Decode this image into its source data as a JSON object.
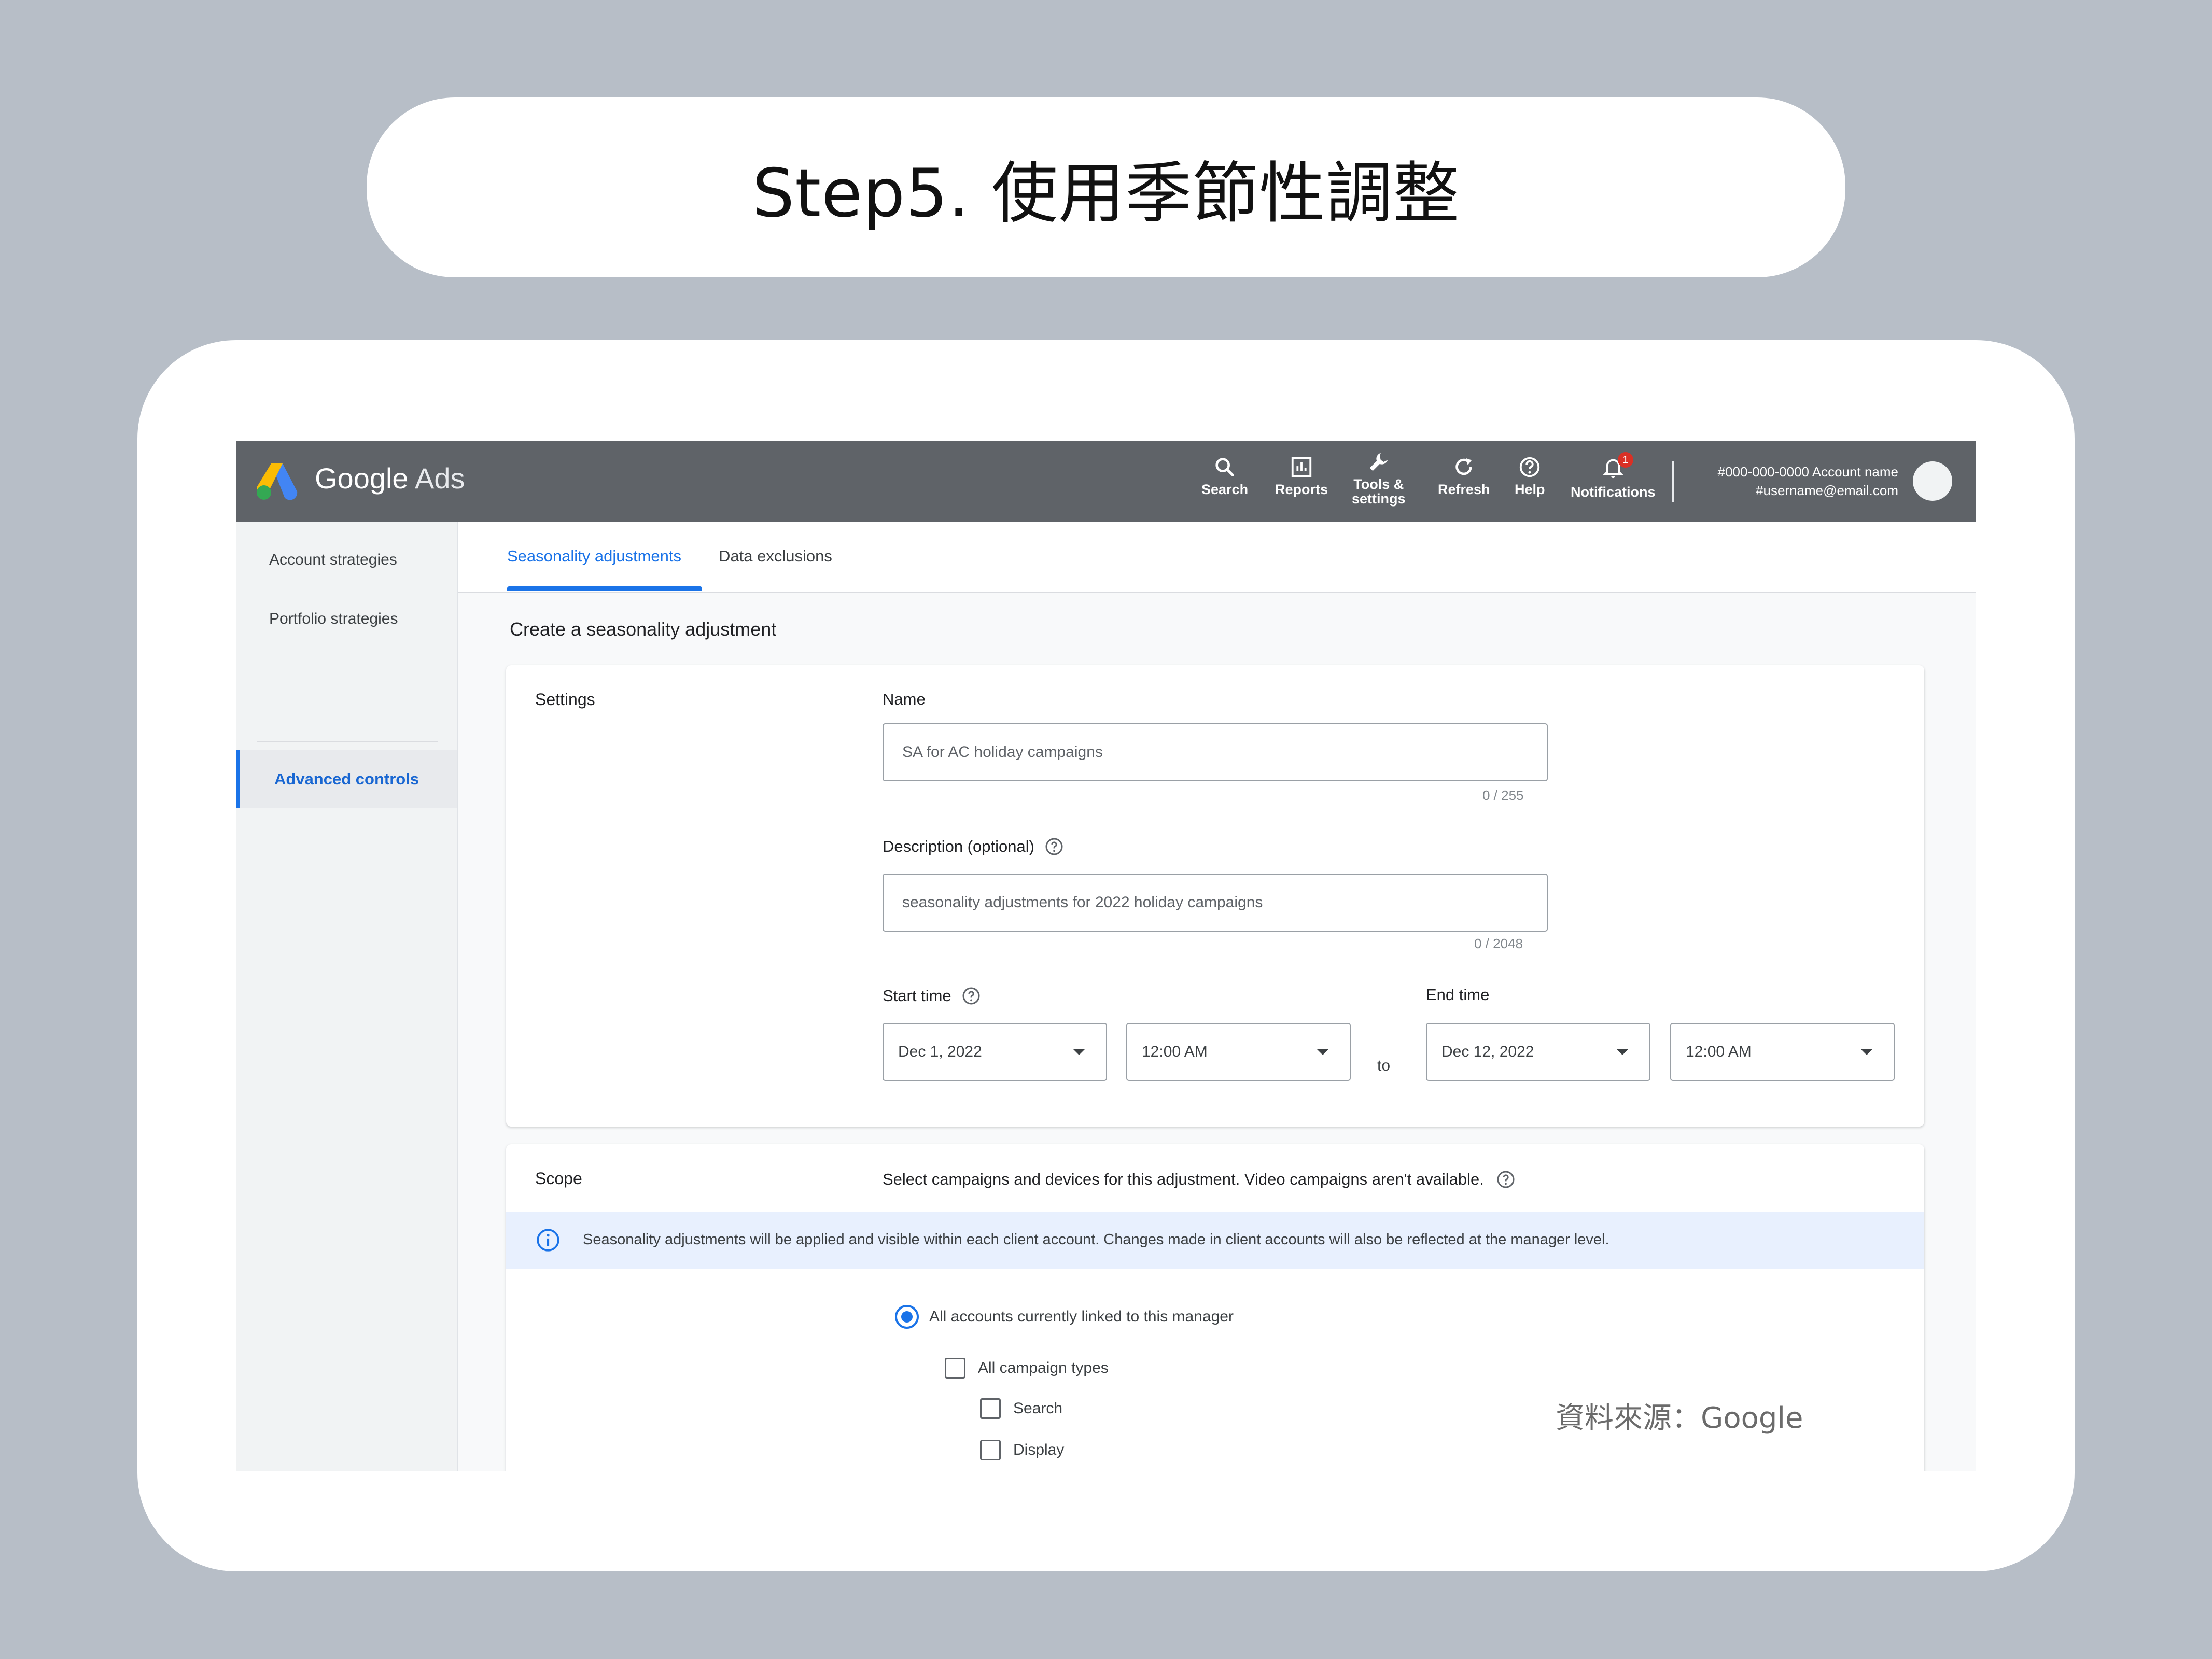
{
  "slide": {
    "title": "Step5. 使用季節性調整",
    "source_note": "資料來源：Google"
  },
  "topbar": {
    "brand": "Google",
    "brand_suffix": "Ads",
    "tools": [
      {
        "label": "Search",
        "icon": "search-icon"
      },
      {
        "label": "Reports",
        "icon": "reports-icon"
      },
      {
        "label": "Tools &\nsettings",
        "icon": "wrench-icon"
      },
      {
        "label": "Refresh",
        "icon": "refresh-icon"
      },
      {
        "label": "Help",
        "icon": "help-icon"
      },
      {
        "label": "Notifications",
        "icon": "bell-icon",
        "badge": "1"
      }
    ],
    "account_line1": "#000-000-0000 Account name",
    "account_line2": "#username@email.com"
  },
  "sidebar": {
    "items": [
      {
        "label": "Account strategies"
      },
      {
        "label": "Portfolio strategies"
      },
      {
        "label": "Advanced controls",
        "active": true
      }
    ]
  },
  "tabs": [
    {
      "label": "Seasonality adjustments",
      "active": true
    },
    {
      "label": "Data exclusions",
      "active": false
    }
  ],
  "main": {
    "section_title": "Create a seasonality adjustment",
    "settings": {
      "label": "Settings",
      "name_label": "Name",
      "name_placeholder": "SA for AC holiday campaigns",
      "name_counter": "0 / 255",
      "desc_label": "Description (optional)",
      "desc_placeholder": "seasonality adjustments for 2022 holiday campaigns",
      "desc_counter": "0 / 2048",
      "start_label": "Start time",
      "start_date": "Dec 1, 2022",
      "start_time": "12:00 AM",
      "to": "to",
      "end_label": "End time",
      "end_date": "Dec 12, 2022",
      "end_time": "12:00 AM"
    },
    "scope": {
      "label": "Scope",
      "description": "Select campaigns and devices for this adjustment. Video campaigns aren't available.",
      "info": "Seasonality adjustments will be applied and visible within each client account. Changes made in client accounts will also be reflected at the manager level.",
      "radio_all": "All accounts currently linked to this manager",
      "all_campaign_types": "All campaign types",
      "options": [
        "Search",
        "Display"
      ]
    }
  },
  "colors": {
    "accent": "#1a73e8",
    "topbar": "#5f6368",
    "page_bg": "#b7bec7"
  }
}
